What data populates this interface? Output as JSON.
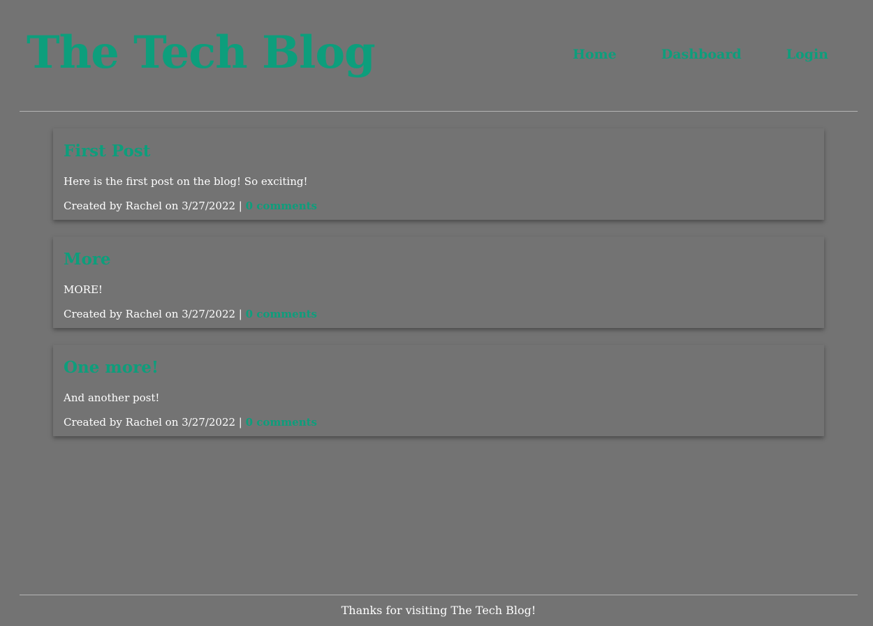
{
  "header": {
    "title": "The Tech Blog",
    "nav": [
      {
        "label": "Home"
      },
      {
        "label": "Dashboard"
      },
      {
        "label": "Login"
      }
    ]
  },
  "posts": [
    {
      "title": "First Post",
      "body": "Here is the first post on the blog! So exciting!",
      "meta_prefix": "Created by Rachel on 3/27/2022 | ",
      "comments_label": "0 comments"
    },
    {
      "title": "More",
      "body": "MORE!",
      "meta_prefix": "Created by Rachel on 3/27/2022 | ",
      "comments_label": "0 comments"
    },
    {
      "title": "One more!",
      "body": "And another post!",
      "meta_prefix": "Created by Rachel on 3/27/2022 | ",
      "comments_label": "0 comments"
    }
  ],
  "footer": {
    "text": "Thanks for visiting The Tech Blog!"
  },
  "colors": {
    "background": "#737373",
    "accent": "#0d9e7c",
    "text": "#ffffff",
    "divider": "#b5b5b5"
  }
}
